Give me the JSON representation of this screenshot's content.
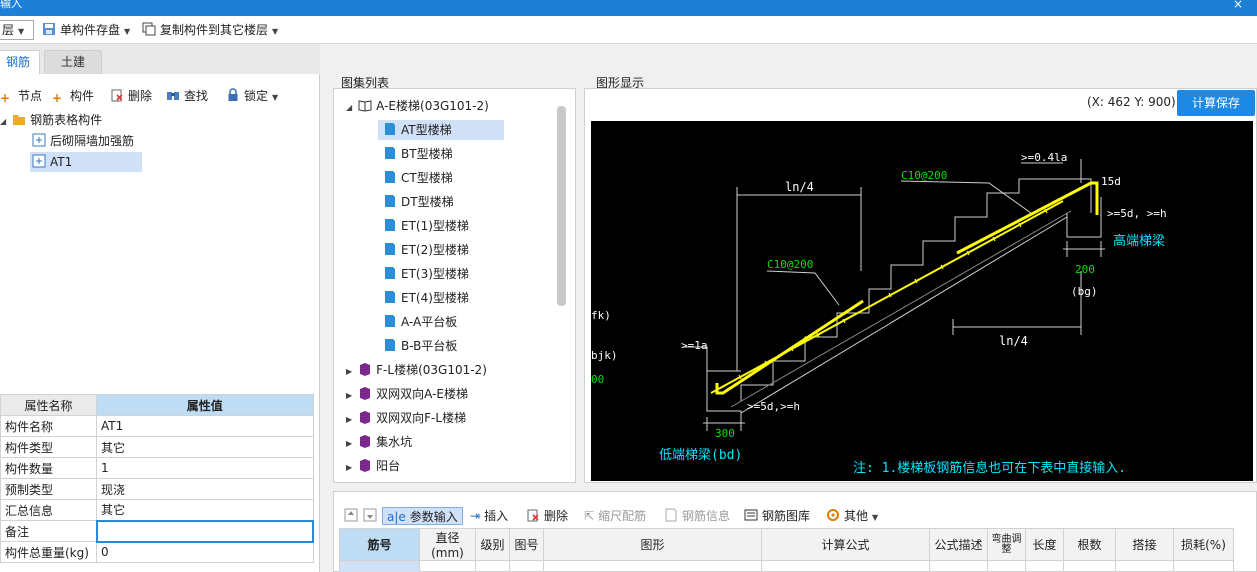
{
  "window": {
    "title": "输入",
    "close_glyph": "×"
  },
  "toolbar": {
    "floor_combo": "层",
    "save_component": "单构件存盘",
    "copy_to_floor": "复制构件到其它楼层"
  },
  "tabs": {
    "rebar": "钢筋",
    "civil": "土建"
  },
  "left_tools": {
    "node": "节点",
    "component": "构件",
    "delete": "删除",
    "find": "查找",
    "lock": "锁定"
  },
  "left_tree": {
    "root": "钢筋表格构件",
    "children": [
      "后砌隔墙加强筋",
      "AT1"
    ]
  },
  "properties": {
    "header_name": "属性名称",
    "header_value": "属性值",
    "rows": [
      {
        "name": "构件名称",
        "value": "AT1"
      },
      {
        "name": "构件类型",
        "value": "其它"
      },
      {
        "name": "构件数量",
        "value": "1"
      },
      {
        "name": "预制类型",
        "value": "现浇"
      },
      {
        "name": "汇总信息",
        "value": "其它"
      },
      {
        "name": "备注",
        "value": ""
      },
      {
        "name": "构件总重量(kg)",
        "value": "0"
      }
    ]
  },
  "atlas": {
    "title": "图集列表",
    "expanded_group": "A-E楼梯(03G101-2)",
    "items": [
      "AT型楼梯",
      "BT型楼梯",
      "CT型楼梯",
      "DT型楼梯",
      "ET(1)型楼梯",
      "ET(2)型楼梯",
      "ET(3)型楼梯",
      "ET(4)型楼梯",
      "A-A平台板",
      "B-B平台板"
    ],
    "groups": [
      "F-L楼梯(03G101-2)",
      "双网双向A-E楼梯",
      "双网双向F-L楼梯",
      "集水坑",
      "阳台"
    ]
  },
  "graphic": {
    "title": "图形显示",
    "coords": "(X: 462 Y: 900)",
    "calc_save": "计算保存"
  },
  "drawing": {
    "labels": {
      "ln4_top": "ln/4",
      "ln4_bottom": "ln/4",
      "rebar_upper": "C10@200",
      "rebar_lower": "C10@200",
      "anchor_top": ">=0.4la",
      "hook_15d": "15d",
      "hook_top": ">=5d, >=h",
      "high_beam": "高端梯梁",
      "dim_200": "200",
      "bg": "(bg)",
      "la": ">=1a",
      "hook_bottom": ">=5d,>=h",
      "dim_300": "300",
      "low_beam": "低端梯梁(bd)",
      "note": "注: 1.楼梯板钢筋信息也可在下表中直接输入.",
      "fk": "fk)",
      "bjk": "bjk)",
      "dim_00": "00"
    },
    "colors": {
      "rebar": "#ffff00",
      "text": "#ffffff",
      "cyan": "#00e5ff",
      "green": "#00e000"
    }
  },
  "bottom_tools": {
    "param_input": "参数输入",
    "insert": "插入",
    "delete": "删除",
    "scale_rebar": "缩尺配筋",
    "rebar_info": "钢筋信息",
    "rebar_library": "钢筋图库",
    "other": "其他"
  },
  "grid": {
    "columns": [
      "筋号",
      "直径(mm)",
      "级别",
      "图号",
      "图形",
      "计算公式",
      "公式描述",
      "弯曲调整",
      "长度",
      "根数",
      "搭接",
      "损耗(%)"
    ]
  }
}
